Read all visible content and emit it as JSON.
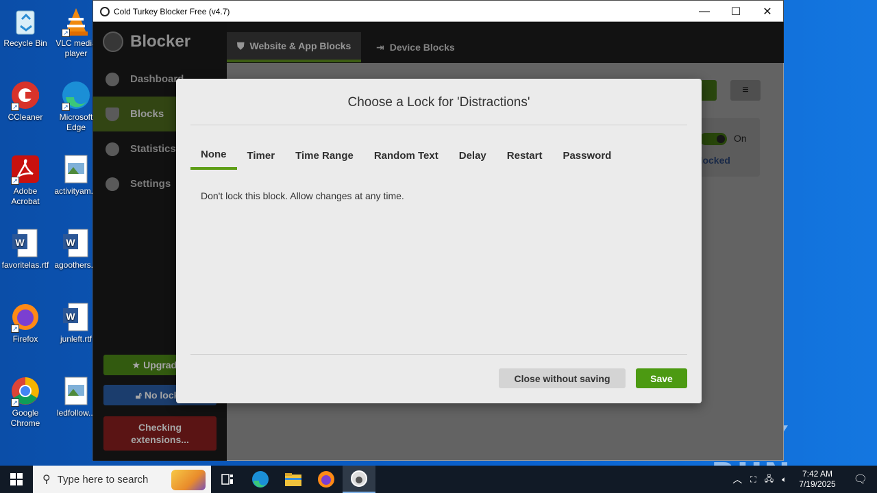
{
  "desktop": {
    "icons": [
      {
        "label": "Recycle Bin"
      },
      {
        "label": "VLC media player"
      },
      {
        "label": "CCleaner"
      },
      {
        "label": "Microsoft Edge"
      },
      {
        "label": "Adobe Acrobat"
      },
      {
        "label": "activityam..."
      },
      {
        "label": "favoritelas.rtf"
      },
      {
        "label": "agoothers..."
      },
      {
        "label": "Firefox"
      },
      {
        "label": "junleft.rtf"
      },
      {
        "label": "Google Chrome"
      },
      {
        "label": "ledfollow..."
      }
    ]
  },
  "window": {
    "title": "Cold Turkey Blocker Free (v4.7)",
    "brand": "Blocker",
    "nav": [
      {
        "label": "Dashboard"
      },
      {
        "label": "Blocks"
      },
      {
        "label": "Statistics"
      },
      {
        "label": "Settings"
      }
    ],
    "sidebar_buttons": {
      "upgrade": "Upgrade t",
      "no_locks": "No locks",
      "checking": "Checking extensions..."
    },
    "tabs": [
      {
        "label": "Website & App Blocks"
      },
      {
        "label": "Device Blocks"
      }
    ],
    "toggle_label": "On",
    "status_text": "nlocked"
  },
  "modal": {
    "title": "Choose a Lock for 'Distractions'",
    "lock_tabs": [
      "None",
      "Timer",
      "Time Range",
      "Random Text",
      "Delay",
      "Restart",
      "Password"
    ],
    "active_tab": "None",
    "description": "Don't lock this block. Allow changes at any time.",
    "close_button": "Close without saving",
    "save_button": "Save"
  },
  "taskbar": {
    "search_placeholder": "Type here to search",
    "time": "7:42 AM",
    "date": "7/19/2025"
  },
  "watermark": "ANY RUN",
  "colors": {
    "accent_green": "#4c9a12",
    "desktop_blue": "#0a62cf"
  }
}
